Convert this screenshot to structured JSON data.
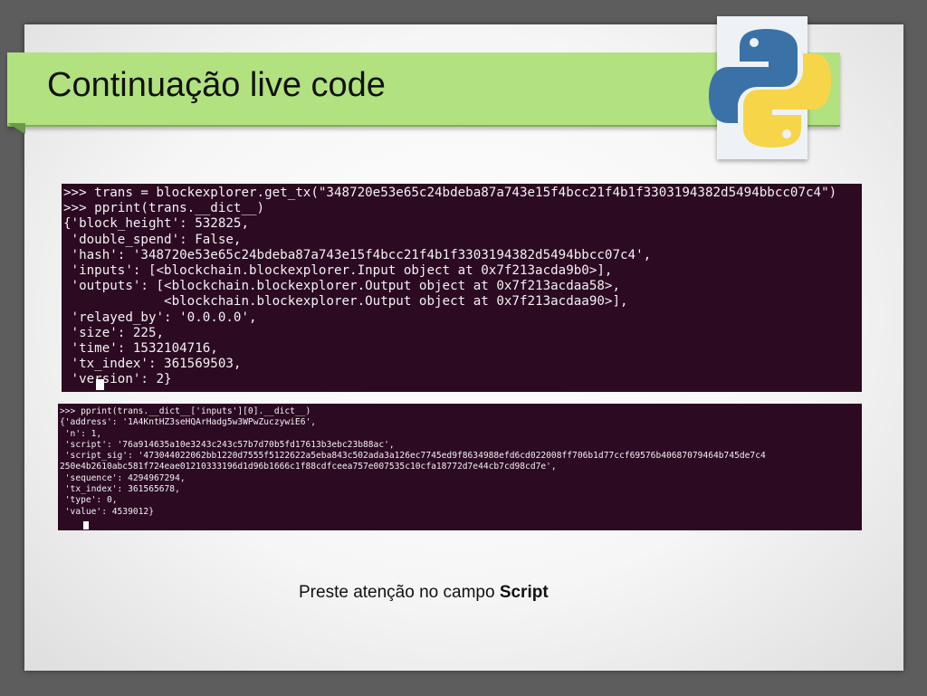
{
  "slide": {
    "title": "Continuação live code",
    "caption_prefix": "Preste atenção no campo ",
    "caption_bold": "Script"
  },
  "logo": {
    "icon": "python-logo-icon",
    "colors": {
      "blue": "#3a72a8",
      "yellow": "#f7d548"
    }
  },
  "terminal1": {
    "lines": [
      ">>> trans = blockexplorer.get_tx(\"348720e53e65c24bdeba87a743e15f4bcc21f4b1f3303194382d5494bbcc07c4\")",
      ">>> pprint(trans.__dict__)",
      "{'block_height': 532825,",
      " 'double_spend': False,",
      " 'hash': '348720e53e65c24bdeba87a743e15f4bcc21f4b1f3303194382d5494bbcc07c4',",
      " 'inputs': [<blockchain.blockexplorer.Input object at 0x7f213acda9b0>],",
      " 'outputs': [<blockchain.blockexplorer.Output object at 0x7f213acdaa58>,",
      "             <blockchain.blockexplorer.Output object at 0x7f213acdaa90>],",
      " 'relayed_by': '0.0.0.0',",
      " 'size': 225,",
      " 'time': 1532104716,",
      " 'tx_index': 361569503,",
      " 'version': 2}"
    ]
  },
  "terminal2": {
    "lines": [
      ">>> pprint(trans.__dict__['inputs'][0].__dict__)",
      "{'address': '1A4KntHZ3seHQArHadg5w3WPwZuczywiE6',",
      " 'n': 1,",
      " 'script': '76a914635a10e3243c243c57b7d70b5fd17613b3ebc23b88ac',",
      " 'script_sig': '473044022062bb1220d7555f5122622a5eba843c502ada3a126ec7745ed9f8634988efd6cd022008ff706b1d77ccf69576b40687079464b745de7c4",
      "250e4b2610abc581f724eae01210333196d1d96b1666c1f88cdfceea757e007535c10cfa18772d7e44cb7cd98cd7e',",
      " 'sequence': 4294967294,",
      " 'tx_index': 361565678,",
      " 'type': 0,",
      " 'value': 4539012}"
    ]
  }
}
